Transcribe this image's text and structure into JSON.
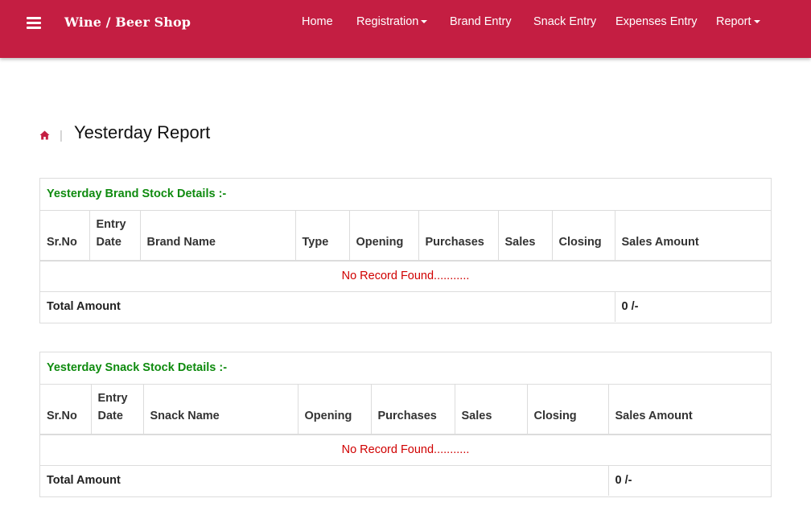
{
  "navbar": {
    "brand": "Wine / Beer Shop",
    "links": {
      "home": "Home",
      "registration": "Registration",
      "brand_entry": "Brand Entry",
      "snack_entry": "Snack Entry",
      "expenses_entry": "Expenses Entry",
      "report": "Report"
    }
  },
  "page": {
    "separator": "|",
    "title": "Yesterday Report"
  },
  "brand_panel": {
    "heading": "Yesterday Brand Stock Details :-",
    "columns": [
      "Sr.No",
      "Entry Date",
      "Brand Name",
      "Type",
      "Opening",
      "Purchases",
      "Sales",
      "Closing",
      "Sales Amount"
    ],
    "empty_message": "No Record Found...........",
    "total_label": "Total Amount",
    "total_value": "0 /-"
  },
  "snack_panel": {
    "heading": "Yesterday Snack Stock Details :-",
    "columns": [
      "Sr.No",
      "Entry Date",
      "Snack Name",
      "Opening",
      "Purchases",
      "Sales",
      "Closing",
      "Sales Amount"
    ],
    "empty_message": "No Record Found...........",
    "total_label": "Total Amount",
    "total_value": "0 /-"
  },
  "colors": {
    "navbar": "#c41e42",
    "heading_green": "#0f8b0f",
    "empty_red": "#d00000"
  }
}
